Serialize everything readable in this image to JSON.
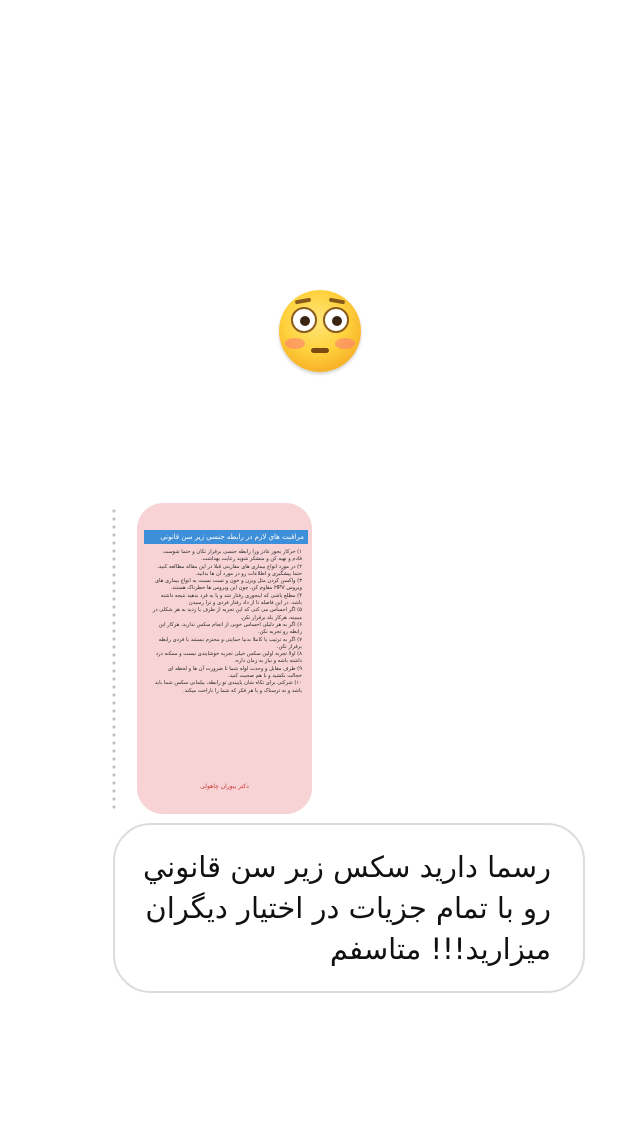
{
  "reaction": {
    "emoji": "😳",
    "icon": "flushed-face-icon"
  },
  "story": {
    "title": "مراقبت هاي لازم در رابطه جنسي زير سن قانوني",
    "paragraphs": [
      "۱) خرکار بجوز غادز ورا رابطه جنسی برقرار نکان و حتما شوست قادم و نهیه کن و متشکر شوید رعایت بهداشت.",
      "۲) در مورد انواع بیماری های مقاربتی قبلا در این مقاله مطالعه کنید، حتما پیشگیری و اطلاعات رو در مورد آن ها بدانید.",
      "۳) واکسن کردن مثل ویزن و خون و تست نسبت به انواع بیماری های ویروس HPV مقاوم کن، چون این ویروس ها خطرناک هستند.",
      "۴) مطلع باشی که اینجوری رفتار شد و پا به فرد بدهید نتیجه داشته باشد. در این فاصله تا از داد رفتار فردی و ترا رسیدن",
      "۵) اگر احساس می کنی که این تجربه از طرف یا زدید به هر شکلی در میبینه، هرکار بلد برقرار نکن.",
      "۶) اگر به هر دلیلی احساس خوبی از انجام سکس ندارید، هرکار این رابطه رو تجربه نکن.",
      "۷) اگر به ترتیب یا کاملا بدنیا حمایتی و محترم نبستند با فردی رابطه برقرار نکن.",
      "۸) اولا تجربه اولین سکس خیلی تجربه خوشایندی نیست و ممکنه درد داشته باشه و نیاز به زمان داره.",
      "۹) طرف مقابل و وحدت لوله شما تا ضرورت آن ها و لحظه ای خجالت نکشید و با هم صحبت کنید.",
      "۱۰) شرکتی برای تکاه شان پاییندی تو رابطه، بیلمانی سکس شما باید باشد و نه ترسناک و یا هر فکر که شما را ناراحت میکند."
    ],
    "author": "دکتر بیوران چاهولی"
  },
  "message": {
    "text": "رسما دارید سکس زیر سن قانوني رو با تمام جزیات در اختیار دیگران میزارید!!! متاسفم"
  }
}
